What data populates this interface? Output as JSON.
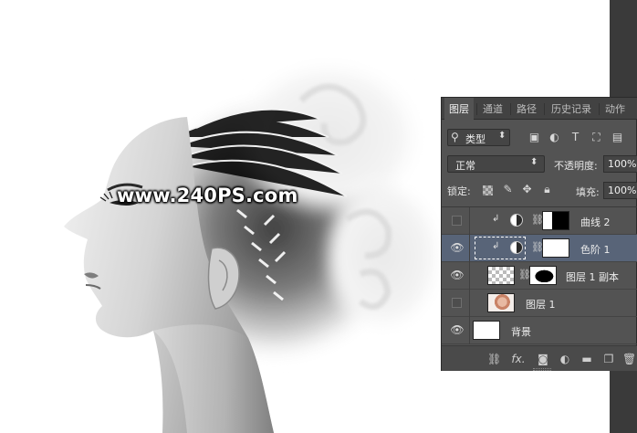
{
  "watermark": "www.240PS.com",
  "layers_panel": {
    "tabs": [
      {
        "label": "图层",
        "active": true
      },
      {
        "label": "通道",
        "active": false
      },
      {
        "label": "路径",
        "active": false
      },
      {
        "label": "历史记录",
        "active": false
      },
      {
        "label": "动作",
        "active": false
      }
    ],
    "filter": {
      "search_icon": "search-icon",
      "label": "类型",
      "arrow": "⬍"
    },
    "filter_icons": [
      "image-filter-icon",
      "adjustment-filter-icon",
      "type-filter-icon",
      "shape-filter-icon",
      "smart-object-filter-icon"
    ],
    "blend_mode": {
      "label": "正常",
      "arrow": "⬍"
    },
    "opacity": {
      "label": "不透明度:",
      "value": "100%"
    },
    "lock": {
      "label": "锁定:"
    },
    "fill": {
      "label": "填充:",
      "value": "100%"
    },
    "layers": [
      {
        "name": "曲线 2",
        "visible": false,
        "selected": false,
        "type": "adjustment-curves",
        "clipped": true
      },
      {
        "name": "色阶 1",
        "visible": true,
        "selected": true,
        "type": "adjustment-levels",
        "clipped": true
      },
      {
        "name": "图层 1 副本",
        "visible": true,
        "selected": false,
        "type": "pixel-with-mask",
        "clipped": false
      },
      {
        "name": "图层 1",
        "visible": false,
        "selected": false,
        "type": "pixel",
        "clipped": false
      },
      {
        "name": "背景",
        "visible": true,
        "selected": false,
        "type": "background",
        "clipped": false
      }
    ],
    "footer_icons": [
      "link-layers-icon",
      "layer-style-fx-icon",
      "add-mask-icon",
      "new-adjustment-icon",
      "new-group-icon",
      "new-layer-icon",
      "delete-layer-icon"
    ],
    "fx_label": "fx."
  }
}
